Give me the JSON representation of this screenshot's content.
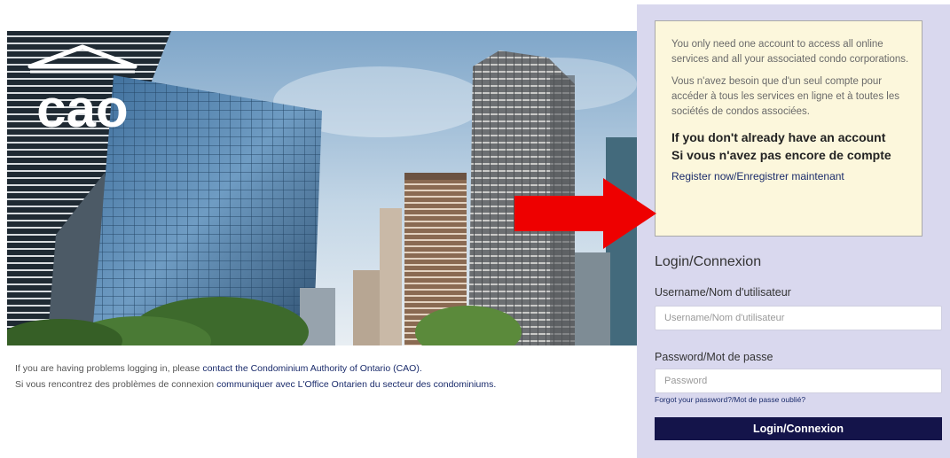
{
  "logo": {
    "text": "cao"
  },
  "help": {
    "line1_prefix": "If you are having problems logging in, please ",
    "line1_link": "contact the Condominium Authority of Ontario (CAO).",
    "line2_prefix": "Si vous rencontrez des problèmes de connexion ",
    "line2_link": "communiquer avec L'Office Ontarien du secteur des condominiums."
  },
  "notice": {
    "paragraph_en": "You only need one account to access all online services and all your associated condo corporations.",
    "paragraph_fr": "Vous n'avez besoin que d'un seul compte pour accéder à tous les services en ligne et à toutes les sociétés de condos associées.",
    "no_account_en": "If you don't already have an account",
    "no_account_fr": "Si vous n'avez pas encore de compte",
    "register_link": "Register now/Enregistrer maintenant"
  },
  "login": {
    "title": "Login/Connexion",
    "username_label": "Username/Nom d'utilisateur",
    "username_placeholder": "Username/Nom d'utilisateur",
    "password_label": "Password/Mot de passe",
    "password_placeholder": "Password",
    "forgot_link": "Forgot your password?/Mot de passe oublié?",
    "button_label": "Login/Connexion"
  },
  "colors": {
    "panel_bg": "#d9d8ee",
    "notice_bg": "#fcf7dc",
    "button_bg": "#14144a",
    "link": "#1a2b6b",
    "arrow": "#ee0000"
  }
}
